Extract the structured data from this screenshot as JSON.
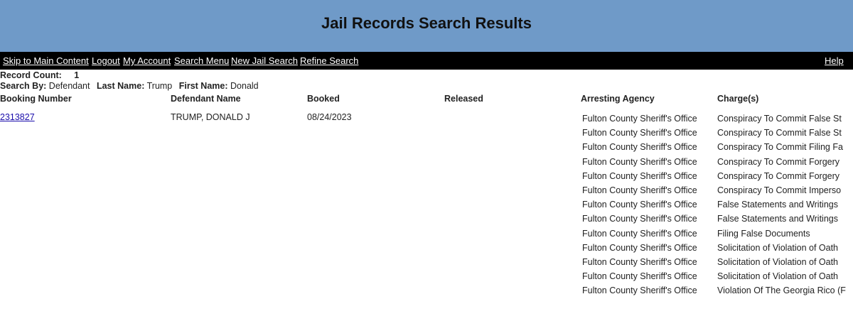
{
  "page": {
    "title": "Jail Records Search Results"
  },
  "nav": {
    "skip": "Skip to Main Content",
    "logout": "Logout",
    "account": "My Account",
    "search_menu": "Search Menu",
    "new_search": "New Jail Search",
    "refine": "Refine Search",
    "help": "Help"
  },
  "info": {
    "record_count_label": "Record Count:",
    "record_count": "1",
    "search_by_label": "Search By:",
    "search_by": "Defendant",
    "last_name_label": "Last Name:",
    "last_name": "Trump",
    "first_name_label": "First Name:",
    "first_name": "Donald"
  },
  "table": {
    "headers": [
      "Booking Number",
      "Defendant Name",
      "Booked",
      "Released",
      "Arresting Agency",
      "Charge(s)"
    ],
    "record": {
      "booking_number": "2313827",
      "defendant_name": "TRUMP, DONALD J",
      "booked": "08/24/2023",
      "released": ""
    },
    "charges": [
      {
        "agency": "Fulton County Sheriff's Office",
        "charge": "Conspiracy To Commit False St"
      },
      {
        "agency": "Fulton County Sheriff's Office",
        "charge": "Conspiracy To Commit False St"
      },
      {
        "agency": "Fulton County Sheriff's Office",
        "charge": "Conspiracy To Commit Filing Fa"
      },
      {
        "agency": "Fulton County Sheriff's Office",
        "charge": "Conspiracy To Commit Forgery"
      },
      {
        "agency": "Fulton County Sheriff's Office",
        "charge": "Conspiracy To Commit Forgery"
      },
      {
        "agency": "Fulton County Sheriff's Office",
        "charge": "Conspiracy To Commit Imperso"
      },
      {
        "agency": "Fulton County Sheriff's Office",
        "charge": "False Statements and Writings"
      },
      {
        "agency": "Fulton County Sheriff's Office",
        "charge": "False Statements and Writings"
      },
      {
        "agency": "Fulton County Sheriff's Office",
        "charge": "Filing False Documents"
      },
      {
        "agency": "Fulton County Sheriff's Office",
        "charge": "Solicitation of Violation of Oath"
      },
      {
        "agency": "Fulton County Sheriff's Office",
        "charge": "Solicitation of Violation of Oath"
      },
      {
        "agency": "Fulton County Sheriff's Office",
        "charge": "Solicitation of Violation of Oath"
      },
      {
        "agency": "Fulton County Sheriff's Office",
        "charge": "Violation Of The Georgia Rico (F"
      }
    ]
  }
}
